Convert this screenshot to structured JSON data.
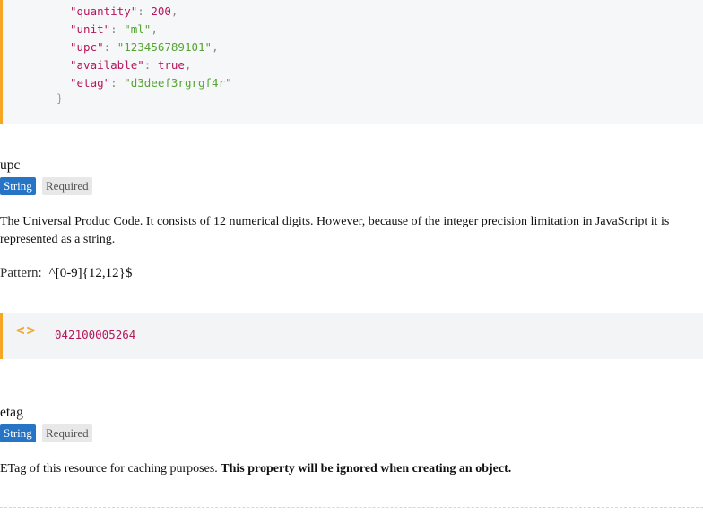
{
  "code": {
    "lines": [
      {
        "key": "\"quantity\"",
        "value": "200",
        "type": "num",
        "comma": ","
      },
      {
        "key": "\"unit\"",
        "value": "\"ml\"",
        "type": "str",
        "comma": ","
      },
      {
        "key": "\"upc\"",
        "value": "\"123456789101\"",
        "type": "str",
        "comma": ","
      },
      {
        "key": "\"available\"",
        "value": "true",
        "type": "bool",
        "comma": ","
      },
      {
        "key": "\"etag\"",
        "value": "\"d3deef3rgrgf4r\"",
        "type": "str",
        "comma": ""
      }
    ],
    "closing_brace": "}"
  },
  "upc": {
    "name": "upc",
    "type_badge": "String",
    "required_badge": "Required",
    "description": "The Universal Produc Code. It consists of 12 numerical digits. However, because of the integer precision limitation in JavaScript it is represented as a string.",
    "pattern_label": "Pattern:",
    "pattern_value": "^[0-9]{12,12}$",
    "example_icon": "<>",
    "example_value": "042100005264"
  },
  "etag": {
    "name": "etag",
    "type_badge": "String",
    "required_badge": "Required",
    "description_plain": "ETag of this resource for caching purposes. ",
    "description_bold": "This property will be ignored when creating an object."
  },
  "colors": {
    "accent": "#f5a623",
    "type_badge": "#2574c6",
    "code_key": "#b5175d",
    "code_string": "#55a532"
  }
}
